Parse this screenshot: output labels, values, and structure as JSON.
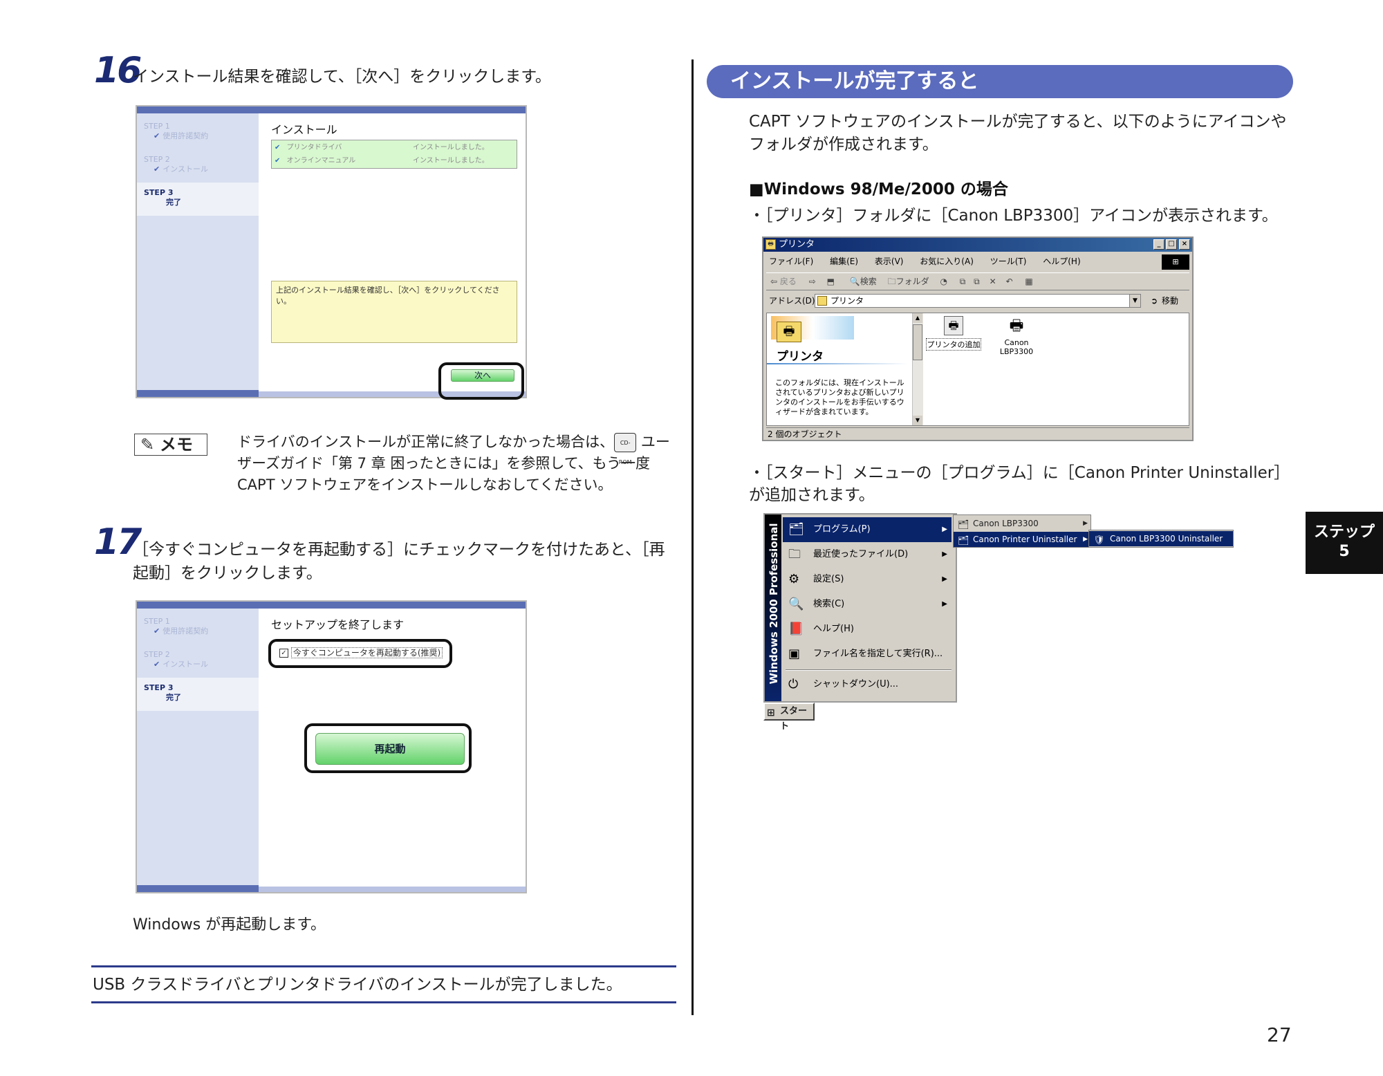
{
  "step16": {
    "number": "16",
    "text": "インストール結果を確認して、［次へ］をクリックします。",
    "shot": {
      "step1_label": "STEP 1",
      "step1_item": "使用許諾契約",
      "step2_label": "STEP 2",
      "step2_item": "インストール",
      "step3_label": "STEP 3",
      "step3_item": "完了",
      "title": "インストール",
      "rows": [
        {
          "name": "プリンタドライバ",
          "status": "インストールしました。"
        },
        {
          "name": "オンラインマニュアル",
          "status": "インストールしました。"
        }
      ],
      "message": "上記のインストール結果を確認し、［次へ］をクリックしてください。",
      "next_button": "次へ"
    }
  },
  "memo": {
    "label": "メモ",
    "text_part1": "ドライバのインストールが正常に終了しなかった場合は、",
    "cdrom_icon_text": "CD-ROM",
    "text_part2": " ユーザーズガイド「第 7 章 困ったときには」を参照して、もう一度 CAPT ソフトウェアをインストールしなおしてください。"
  },
  "step17": {
    "number": "17",
    "text": "［今すぐコンピュータを再起動する］にチェックマークを付けたあと、［再起動］をクリックします。",
    "shot": {
      "step1_label": "STEP 1",
      "step1_item": "使用許諾契約",
      "step2_label": "STEP 2",
      "step2_item": "インストール",
      "step3_label": "STEP 3",
      "step3_item": "完了",
      "title": "セットアップを終了します",
      "checkbox_label": "今すぐコンピュータを再起動する(推奨)",
      "restart_button": "再起動"
    },
    "after_text": "Windows が再起動します。"
  },
  "completion_note": "USB クラスドライバとプリンタドライバのインストールが完了しました。",
  "right": {
    "section_title": "インストールが完了すると",
    "intro": "CAPT ソフトウェアのインストールが完了すると、以下のようにアイコンやフォルダが作成されます。",
    "subheading": "■Windows 98/Me/2000 の場合",
    "bullet1": "・［プリンタ］フォルダに［Canon LBP3300］アイコンが表示されます。",
    "printer_window": {
      "title": "プリンタ",
      "menus": [
        "ファイル(F)",
        "編集(E)",
        "表示(V)",
        "お気に入り(A)",
        "ツール(T)",
        "ヘルプ(H)"
      ],
      "toolbar_back": "戻る",
      "toolbar_search": "検索",
      "toolbar_folder": "フォルダ",
      "address_label": "アドレス(D)",
      "address_value": "プリンタ",
      "go_label": "移動",
      "panel_title": "プリンタ",
      "panel_text": "このフォルダには、現在インストールされているプリンタおよび新しいプリンタのインストールをお手伝いするウィザードが含まれています。",
      "icon_add": "プリンタの追加",
      "icon_canon_line1": "Canon",
      "icon_canon_line2": "LBP3300",
      "status": "2 個のオブジェクト"
    },
    "bullet2": "・［スタート］メニューの［プログラム］に［Canon Printer Uninstaller］が追加されます。",
    "start_menu": {
      "banner": "Windows 2000 Professional",
      "items": [
        "プログラム(P)",
        "最近使ったファイル(D)",
        "設定(S)",
        "検索(C)",
        "ヘルプ(H)",
        "ファイル名を指定して実行(R)...",
        "シャットダウン(U)..."
      ],
      "submenu1": [
        "Canon LBP3300",
        "Canon Printer Uninstaller"
      ],
      "submenu2": [
        "Canon LBP3300 Uninstaller"
      ],
      "start_button": "スタート"
    }
  },
  "side_tab": {
    "label": "ステップ",
    "number": "5"
  },
  "page_number": "27"
}
